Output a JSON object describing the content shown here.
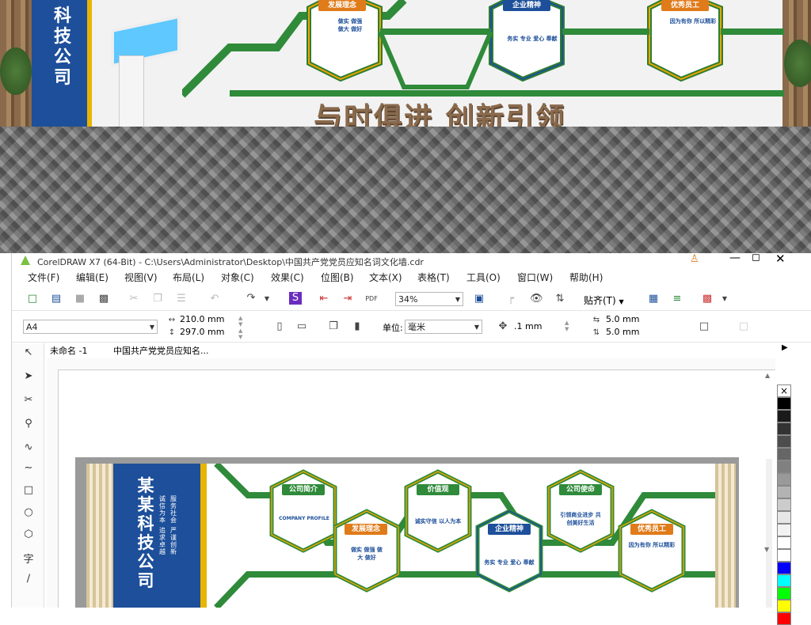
{
  "render": {
    "slogan": "与时俱进 创新引领",
    "brand_vertical": "科技公司",
    "mini_slogan1": "务实 专业 爱心 奉献",
    "cards": [
      "发展理念",
      "企业精神",
      "优秀员工"
    ],
    "card_texts": [
      "做实 做强",
      "做大 做好",
      "因为有你 所以精彩"
    ]
  },
  "window": {
    "title": "CorelDRAW X7 (64-Bit) - C:\\Users\\Administrator\\Desktop\\中国共产党党员应知名词文化墙.cdr",
    "menu": [
      "文件(F)",
      "编辑(E)",
      "视图(V)",
      "布局(L)",
      "对象(C)",
      "效果(C)",
      "位图(B)",
      "文本(X)",
      "表格(T)",
      "工具(O)",
      "窗口(W)",
      "帮助(H)"
    ],
    "zoom": "34%",
    "snap_label": "贴齐(T)",
    "page_size": "A4",
    "width": "210.0 mm",
    "height": "297.0 mm",
    "unit_label": "单位:",
    "unit_value": "毫米",
    "nudge": ".1 mm",
    "dup_x": "5.0 mm",
    "dup_y": "5.0 mm",
    "tabs": [
      "未命名 -1",
      "中国共产党党员应知名..."
    ],
    "doc": {
      "brand": "某某科技公司",
      "side_text": [
        "诚信为本",
        "追求卓越",
        "服务社会",
        "严谨创新"
      ],
      "cards": [
        {
          "label": "公司简介",
          "sub": "COMPANY PROFILE",
          "color": "green"
        },
        {
          "label": "发展理念",
          "sub": "做实 做强 做大 做好",
          "color": "orange"
        },
        {
          "label": "价值观",
          "sub": "诚实守信 以人为本",
          "color": "green"
        },
        {
          "label": "企业精神",
          "sub": "务实 专业 爱心 奉献",
          "color": "blue"
        },
        {
          "label": "公司使命",
          "sub": "引领商业进步 共创美好生活",
          "color": "green"
        },
        {
          "label": "优秀员工",
          "sub": "因为有你 所以精彩",
          "color": "orange"
        }
      ]
    },
    "palette": [
      "#ffffff",
      "#000000",
      "#1a1a1a",
      "#333333",
      "#4d4d4d",
      "#666666",
      "#808080",
      "#999999",
      "#b3b3b3",
      "#cccccc",
      "#e6e6e6",
      "#f2f2f2",
      "#ffffff",
      "#ffffff",
      "#0000ff",
      "#00ffff",
      "#00ff00",
      "#ffff00",
      "#ff0000"
    ]
  }
}
